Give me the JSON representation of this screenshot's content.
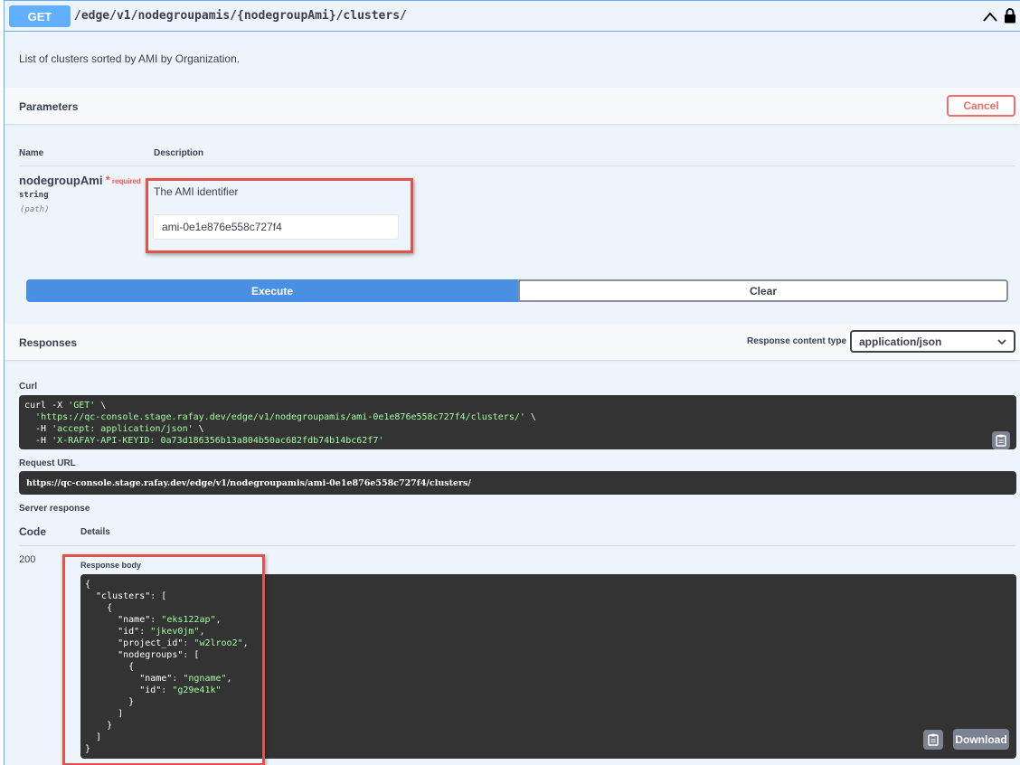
{
  "operation": {
    "method": "GET",
    "path": "/edge/v1/nodegroupamis/{nodegroupAmi}/clusters/",
    "description": "List of clusters sorted by AMI by Organization."
  },
  "parameters": {
    "title": "Parameters",
    "cancel_label": "Cancel",
    "col_name": "Name",
    "col_description": "Description",
    "param": {
      "name": "nodegroupAmi",
      "required_star": "*",
      "required_label": "required",
      "type": "string",
      "location": "(path)",
      "description": "The AMI identifier",
      "value": "ami-0e1e876e558c727f4"
    },
    "execute_label": "Execute",
    "clear_label": "Clear"
  },
  "responses": {
    "title": "Responses",
    "content_type_label": "Response content type",
    "content_type_value": "application/json",
    "curl_label": "Curl",
    "curl_lines": [
      {
        "plain": "curl -X ",
        "str": "'GET'",
        "tail": " \\"
      },
      {
        "plain": "  ",
        "str": "'https://qc-console.stage.rafay.dev/edge/v1/nodegroupamis/ami-0e1e876e558c727f4/clusters/'",
        "tail": " \\"
      },
      {
        "plain": "  -H ",
        "str": "'accept: application/json'",
        "tail": " \\"
      },
      {
        "plain": "  -H ",
        "str": "'X-RAFAY-API-KEYID: 0a73d186356b13a804b50ac682fdb74b14bc62f7'",
        "tail": ""
      }
    ],
    "request_url_label": "Request URL",
    "request_url": "https://qc-console.stage.rafay.dev/edge/v1/nodegroupamis/ami-0e1e876e558c727f4/clusters/",
    "server_response_label": "Server response",
    "code_col": "Code",
    "details_col": "Details",
    "status_code": "200",
    "body_label": "Response body",
    "body_lines": [
      {
        "plain": "{",
        "str": "",
        "tail": ""
      },
      {
        "plain": "  \"clusters\": [",
        "str": "",
        "tail": ""
      },
      {
        "plain": "    {",
        "str": "",
        "tail": ""
      },
      {
        "plain": "      \"name\": ",
        "str": "\"eks122ap\"",
        "tail": ","
      },
      {
        "plain": "      \"id\": ",
        "str": "\"jkev0jm\"",
        "tail": ","
      },
      {
        "plain": "      \"project_id\": ",
        "str": "\"w2lroo2\"",
        "tail": ","
      },
      {
        "plain": "      \"nodegroups\": [",
        "str": "",
        "tail": ""
      },
      {
        "plain": "        {",
        "str": "",
        "tail": ""
      },
      {
        "plain": "          \"name\": ",
        "str": "\"ngname\"",
        "tail": ","
      },
      {
        "plain": "          \"id\": ",
        "str": "\"g29e41k\"",
        "tail": ""
      },
      {
        "plain": "        }",
        "str": "",
        "tail": ""
      },
      {
        "plain": "      ]",
        "str": "",
        "tail": ""
      },
      {
        "plain": "    }",
        "str": "",
        "tail": ""
      },
      {
        "plain": "  ]",
        "str": "",
        "tail": ""
      },
      {
        "plain": "}",
        "str": "",
        "tail": ""
      }
    ],
    "download_label": "Download"
  },
  "icons": {
    "collapse": "chevron-up-icon",
    "lock": "lock-icon",
    "dropdown": "chevron-down-icon",
    "copy": "clipboard-icon"
  },
  "colors": {
    "method_get": "#61affe",
    "execute": "#4990e2",
    "cancel": "#f36b6b",
    "highlight": "#e0524a",
    "code_bg": "#333333",
    "code_string": "#a2fca2"
  }
}
